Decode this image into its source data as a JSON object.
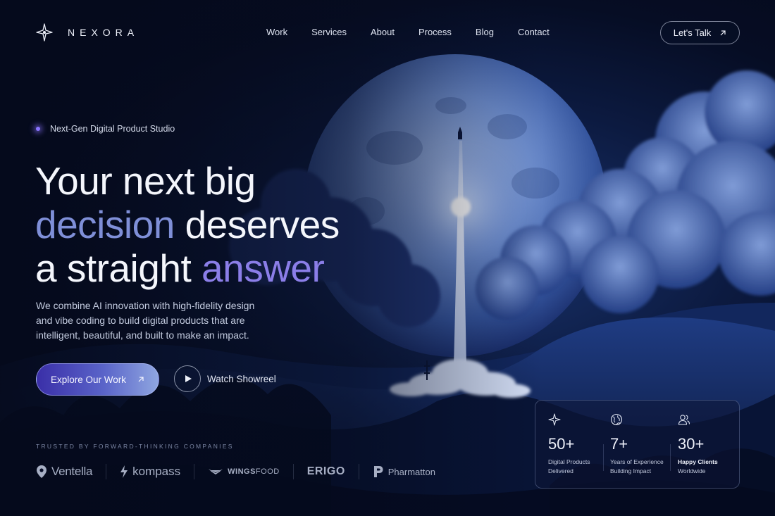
{
  "brand": {
    "name": "NEXORA",
    "icon": "sparkle-star-icon"
  },
  "nav": {
    "items": [
      "Work",
      "Services",
      "About",
      "Process",
      "Blog",
      "Contact"
    ],
    "cta_label": "Let's Talk",
    "cta_icon": "arrow-up-right-icon"
  },
  "hero": {
    "eyebrow": "Next-Gen Digital Product Studio",
    "headline": {
      "line1": "Your next big",
      "line2_accent": "decision",
      "line2_rest": " deserves",
      "line3_start": "a straight ",
      "line3_accent": "answer"
    },
    "description": "We combine AI innovation with high-fidelity design and vibe coding to build digital products that are intelligent, beautiful, and built to make an impact.",
    "primary_cta": "Explore Our Work",
    "secondary_cta": "Watch Showreel"
  },
  "trusted": {
    "label": "TRUSTED BY FORWARD-THINKING COMPANIES",
    "brands": [
      {
        "name": "Ventella",
        "icon": "location-pin-icon"
      },
      {
        "name": "kompass",
        "icon": "bolt-icon"
      },
      {
        "name_bold": "WINGS",
        "name_light": "FOOD",
        "icon": "wings-icon"
      },
      {
        "name": "ERIGO"
      },
      {
        "name": "Pharmatton",
        "icon": "p-monogram-icon"
      }
    ]
  },
  "stats": [
    {
      "icon": "sparkle-icon",
      "value": "50+",
      "line1": "Digital Products",
      "line2": "Delivered"
    },
    {
      "icon": "globe-icon",
      "value": "7+",
      "line1": "Years of Experience",
      "line2": "Building Impact"
    },
    {
      "icon": "users-icon",
      "value": "30+",
      "line1": "Happy Clients",
      "line2": "Worldwide"
    }
  ],
  "colors": {
    "background": "#050a1c",
    "accent_blue": "#7f8fd8",
    "accent_violet": "#8b7ee8",
    "cta_gradient_start": "#3a2fa8",
    "cta_gradient_end": "#8fa6e0"
  }
}
